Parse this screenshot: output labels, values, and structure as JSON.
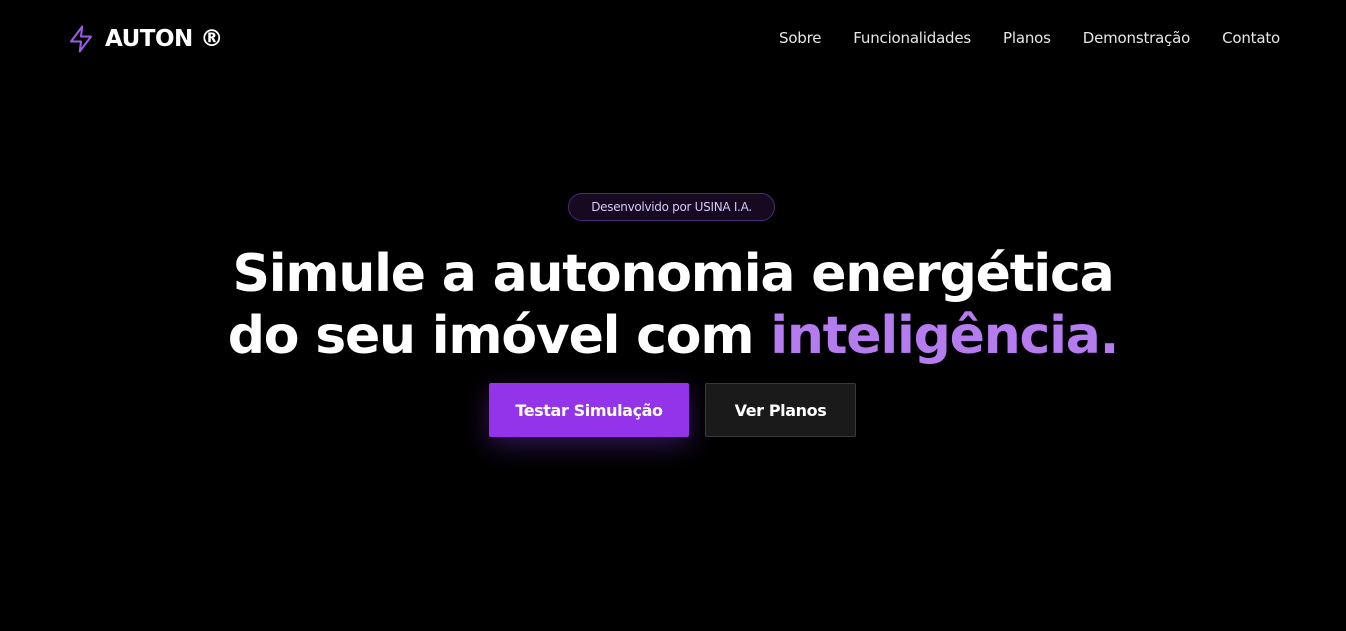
{
  "header": {
    "brand": {
      "name": "AUTON",
      "mark": "®",
      "icon": "lightning-bolt-icon",
      "icon_color": "#9b5de5"
    },
    "nav": [
      {
        "label": "Sobre"
      },
      {
        "label": "Funcionalidades"
      },
      {
        "label": "Planos"
      },
      {
        "label": "Demonstração"
      },
      {
        "label": "Contato"
      }
    ]
  },
  "hero": {
    "badge": "Desenvolvido por USINA I.A.",
    "headline_line1": "Simule a autonomia energética",
    "headline_line2_prefix": "do seu imóvel com ",
    "headline_accent": "inteligência.",
    "primary_cta": "Testar Simulação",
    "secondary_cta": "Ver Planos"
  },
  "colors": {
    "background": "#000000",
    "accent": "#b57cf0",
    "primary_button": "#9333ea",
    "secondary_button": "#1a1a1a"
  }
}
